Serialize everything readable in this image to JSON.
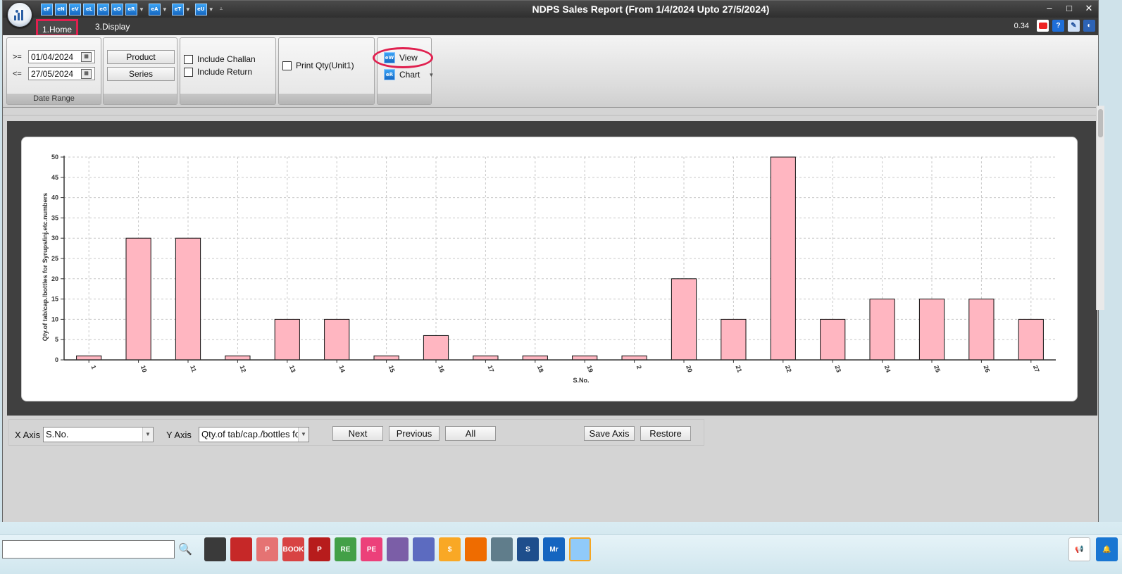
{
  "window": {
    "title": "NDPS Sales Report (From 1/4/2024 Upto 27/5/2024)",
    "controls": [
      "–",
      "□",
      "✕"
    ]
  },
  "qat": [
    "eF",
    "eN",
    "eV",
    "eL",
    "eG",
    "eO",
    "eR",
    "eA",
    "eT",
    "eU"
  ],
  "tabs": {
    "home": "1.Home",
    "display": "3.Display"
  },
  "toolbar_right": {
    "zoom": "0.34"
  },
  "ribbon": {
    "date_range": {
      "label": "Date Range",
      "from_op": ">=",
      "from": "01/04/2024",
      "to_op": "<=",
      "to": "27/05/2024"
    },
    "filter_buttons": {
      "product": "Product",
      "series": "Series"
    },
    "options": {
      "include_challan": "Include Challan",
      "include_return": "Include Return"
    },
    "print": {
      "print_qty": "Print Qty(Unit1)"
    },
    "view_group": {
      "view": "View",
      "chart": "Chart",
      "view_icon": "eW",
      "chart_icon": "eR"
    }
  },
  "chart_data": {
    "type": "bar",
    "categories": [
      "1",
      "10",
      "11",
      "12",
      "13",
      "14",
      "15",
      "16",
      "17",
      "18",
      "19",
      "2",
      "20",
      "21",
      "22",
      "23",
      "24",
      "25",
      "26",
      "27"
    ],
    "values": [
      1,
      30,
      30,
      1,
      10,
      10,
      1,
      6,
      1,
      1,
      1,
      1,
      20,
      10,
      50,
      10,
      15,
      15,
      15,
      10
    ],
    "xlabel": "S.No.",
    "ylabel": "Qty.of tab/cap./bottles for Syrups/inj.etc.numbers",
    "ylim": [
      0,
      50
    ],
    "yticks": [
      0,
      5,
      10,
      15,
      20,
      25,
      30,
      35,
      40,
      45,
      50
    ],
    "grid": true,
    "bar_color": "#ffb6c1"
  },
  "axis_controls": {
    "x_label": "X Axis",
    "x_value": "S.No.",
    "y_label": "Y Axis",
    "y_value": "Qty.of tab/cap./bottles fo",
    "next": "Next",
    "previous": "Previous",
    "all": "All",
    "save_axis": "Save Axis",
    "restore": "Restore"
  },
  "taskbar": {
    "icons": [
      {
        "name": "tb-app-1",
        "label": "",
        "color": "#3a3a3a"
      },
      {
        "name": "tb-app-2",
        "label": "",
        "color": "#c62828"
      },
      {
        "name": "tb-app-3",
        "label": "P",
        "color": "#e57373"
      },
      {
        "name": "tb-app-4",
        "label": "BOOK",
        "color": "#d84343"
      },
      {
        "name": "tb-app-5",
        "label": "P",
        "color": "#b71c1c"
      },
      {
        "name": "tb-app-6",
        "label": "RE",
        "color": "#43a047"
      },
      {
        "name": "tb-app-7",
        "label": "PE",
        "color": "#ec407a"
      },
      {
        "name": "tb-app-8",
        "label": "",
        "color": "#7b5ea7"
      },
      {
        "name": "tb-app-9",
        "label": "",
        "color": "#5c6bc0"
      },
      {
        "name": "tb-app-10",
        "label": "$",
        "color": "#f9a825"
      },
      {
        "name": "tb-app-11",
        "label": "",
        "color": "#ef6c00"
      },
      {
        "name": "tb-app-12",
        "label": "",
        "color": "#607d8b"
      },
      {
        "name": "tb-app-13",
        "label": "S",
        "color": "#1e4e8c"
      },
      {
        "name": "tb-app-14",
        "label": "Mr",
        "color": "#1565c0"
      },
      {
        "name": "tb-app-15",
        "label": "",
        "color": "#90caf9"
      }
    ]
  }
}
